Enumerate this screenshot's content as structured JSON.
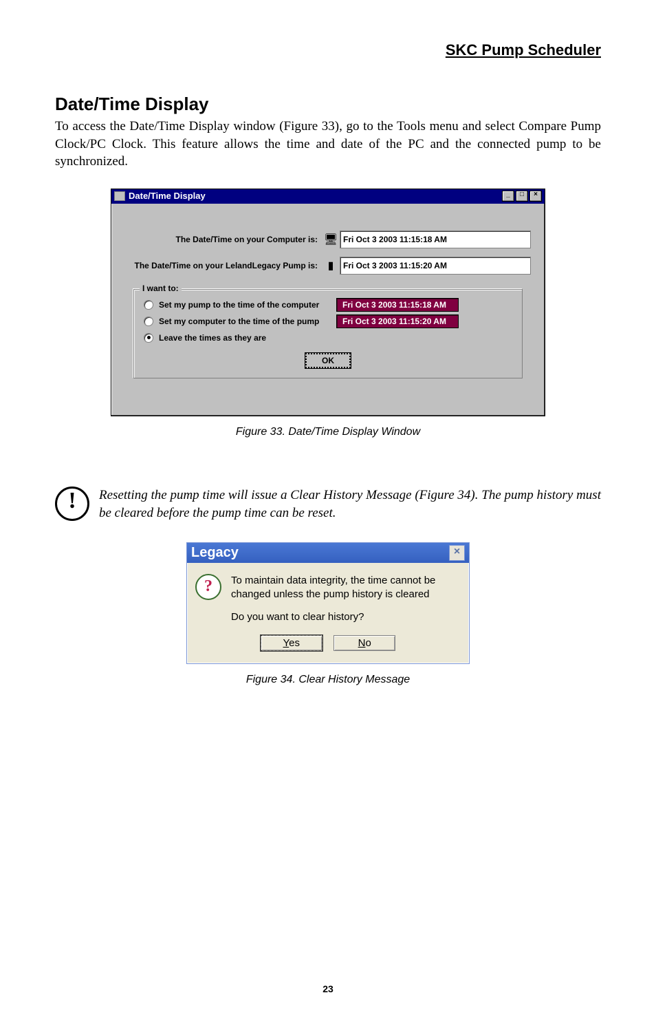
{
  "header": {
    "right": "SKC Pump Scheduler"
  },
  "section": {
    "title": "Date/Time Display",
    "body": "To access the Date/Time Display window (Figure 33), go to the Tools menu and select Compare Pump Clock/PC Clock. This feature allows the time and date of the PC and the connected pump to be synchronized."
  },
  "fig33": {
    "window_title": "Date/Time Display",
    "row_pc_label": "The Date/Time on your Computer is:",
    "row_pc_value": "Fri Oct 3 2003   11:15:18 AM",
    "row_pump_label": "The Date/Time on your LelandLegacy Pump is:",
    "row_pump_value": "Fri Oct 3 2003  11:15:20 AM",
    "group_title": "I want to:",
    "opt1_label": "Set my pump to the time of the computer",
    "opt1_value": "Fri Oct 3 2003   11:15:18 AM",
    "opt2_label": "Set my computer to the time of the pump",
    "opt2_value": "Fri Oct 3 2003  11:15:20 AM",
    "opt3_label": "Leave the times as they are",
    "ok": "OK",
    "caption": "Figure 33. Date/Time Display Window"
  },
  "note": {
    "text": "Resetting the pump time will issue a Clear History Message (Figure 34). The pump history must be cleared before the pump time can be reset."
  },
  "fig34": {
    "title": "Legacy",
    "msg": "To maintain data integrity, the time cannot be changed unless the pump history is cleared",
    "question": "Do you want to clear history?",
    "yes": "Yes",
    "no": "No",
    "caption": "Figure 34. Clear History Message"
  },
  "page_number": "23"
}
